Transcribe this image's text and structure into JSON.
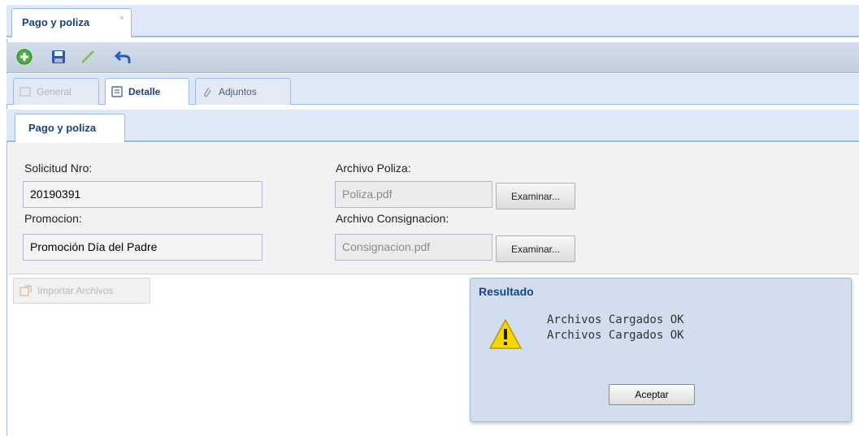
{
  "window_tab": {
    "title": "Pago y poliza",
    "close_glyph": "×"
  },
  "toolbar": {
    "items": [
      {
        "name": "add-icon",
        "color": "#4caf3c"
      },
      {
        "name": "save-icon",
        "color": "#2a5aa8"
      },
      {
        "name": "edit-pencil-icon",
        "color": "#7dbb5a"
      },
      {
        "name": "undo-icon",
        "color": "#1f5fc4"
      }
    ]
  },
  "tabs": [
    {
      "label": "General",
      "icon": "general-icon",
      "state": "disabled"
    },
    {
      "label": "Detalle",
      "icon": "detail-icon",
      "state": "active"
    },
    {
      "label": "Adjuntos",
      "icon": "paperclip-icon",
      "state": "normal"
    }
  ],
  "panel": {
    "title": "Pago y poliza"
  },
  "form": {
    "solicitud_label": "Solicitud Nro:",
    "solicitud_value": "20190391",
    "promocion_label": "Promocion:",
    "promocion_value": "Promoción Día del Padre",
    "archivo_poliza_label": "Archivo Poliza:",
    "archivo_poliza_value": "Poliza.pdf",
    "archivo_consignacion_label": "Archivo Consignacion:",
    "archivo_consignacion_value": "Consignacion.pdf",
    "browse_label": "Examinar..."
  },
  "import_button": {
    "label": "Importar Archivos"
  },
  "dialog": {
    "title": "Resultado",
    "icon": "warning-icon",
    "messages": [
      "Archivos Cargados OK",
      "Archivos Cargados OK"
    ],
    "button_label": "Aceptar"
  },
  "colors": {
    "accent": "#15428b",
    "border": "#99bbe8",
    "strip": "#dfe8f6",
    "warning": "#f5d800"
  }
}
